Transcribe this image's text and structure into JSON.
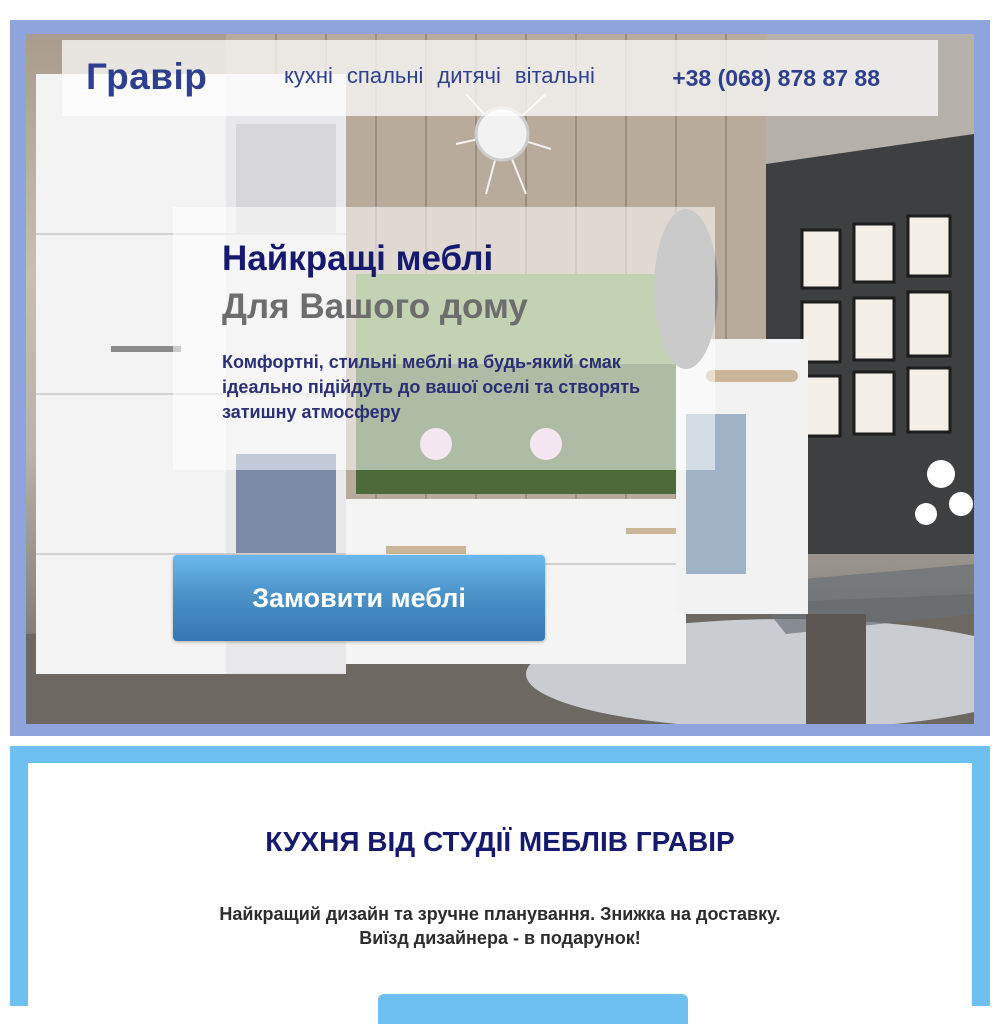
{
  "header": {
    "logo": "Гравір",
    "nav": [
      "кухні",
      "спальні",
      "дитячі",
      "вітальні"
    ],
    "phone": "+38 (068) 878 87 88"
  },
  "hero": {
    "title": "Найкращі меблі",
    "subtitle": "Для Вашого дому",
    "description_lines": [
      "Комфортні, стильні меблі на будь-який смак",
      "ідеально підійдуть до вашої оселі та створять",
      "затишну атмосферу"
    ],
    "cta_label": "Замовити меблі"
  },
  "section": {
    "title": "КУХНЯ ВІД СТУДІЇ МЕБЛІВ ГРАВІР",
    "text_lines": [
      "Найкращий дизайн та зручне планування.  Знижка на доставку.",
      "Виїзд дизайнера - в подарунок!"
    ]
  },
  "colors": {
    "brand_dark": "#151a6e",
    "brand": "#2f3f8f",
    "accent_blue": "#6ec0f0",
    "frame_blue": "#8fa4dc"
  }
}
